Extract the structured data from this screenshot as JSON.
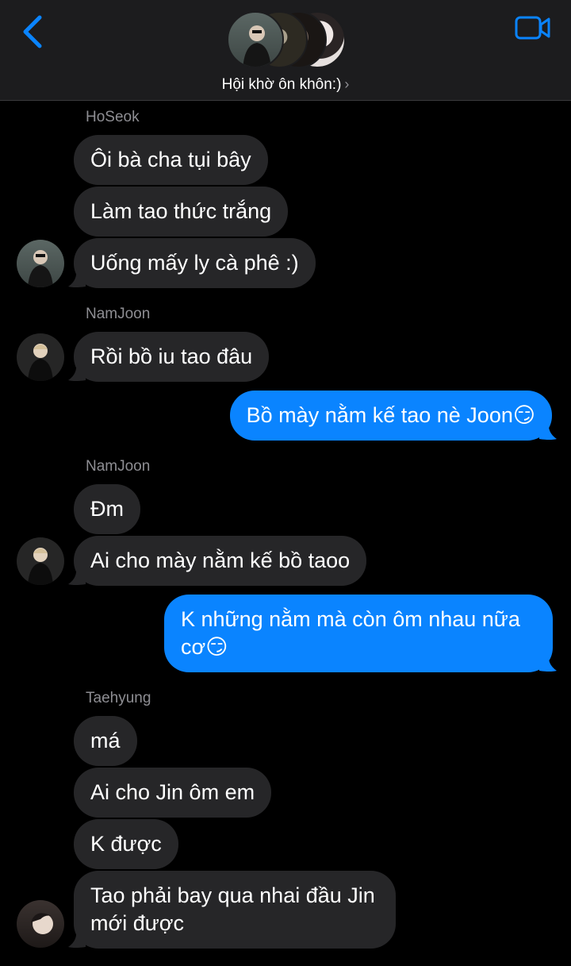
{
  "header": {
    "group_name": "Hội khờ ôn khôn:)",
    "back_icon": "chevron-left-icon",
    "video_icon": "video-camera-icon",
    "accent": "#0a84ff"
  },
  "messages": [
    {
      "sender": "HoSeok",
      "texts": [
        "Ôi bà cha tụi bây",
        "Làm tao thức trắng",
        "Uống mấy ly cà phê :)"
      ]
    },
    {
      "sender": "NamJoon",
      "texts": [
        "Rồi bồ iu tao đâu"
      ]
    },
    {
      "outgoing": [
        "Bồ mày nằm kế tao nè Joon😏"
      ]
    },
    {
      "sender": "NamJoon",
      "texts": [
        "Đm",
        "Ai cho mày nằm kế bồ taoo"
      ]
    },
    {
      "outgoing": [
        "K những nằm mà còn ôm nhau nữa cơ😏"
      ]
    },
    {
      "sender": "Taehyung",
      "texts": [
        "má",
        "Ai cho Jin ôm em",
        "K được",
        "Tao phải bay qua nhai đầu Jin mới được"
      ]
    }
  ],
  "colors": {
    "incoming_bubble": "#262628",
    "outgoing_bubble": "#0a84ff",
    "header_bg": "#1c1c1e",
    "sender_name": "#8e8e93"
  }
}
